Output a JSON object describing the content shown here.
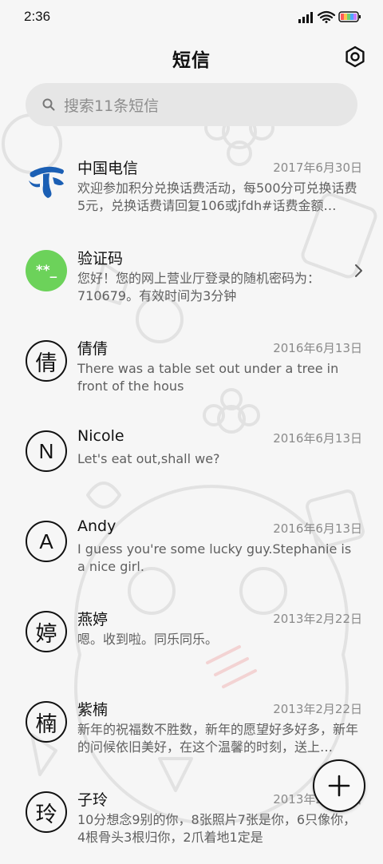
{
  "status_bar": {
    "time": "2:36",
    "icons": [
      "signal-icon",
      "wifi-icon",
      "battery-icon"
    ]
  },
  "header": {
    "title": "短信",
    "settings_icon": "settings-icon"
  },
  "search": {
    "placeholder": "搜索11条短信",
    "icon": "search-icon"
  },
  "conversations": [
    {
      "name": "中国电信",
      "date": "2017年6月30日",
      "preview": "欢迎参加积分兑换话费活动，每500分可兑换话费5元，兑换话费请回复106或jfdh#话费金额…",
      "avatar": "china-telecom-logo"
    },
    {
      "name": "验证码",
      "date": "",
      "preview": "您好！您的网上营业厅登录的随机密码为：710679。有效时间为3分钟",
      "avatar": "**_"
    },
    {
      "name": "倩倩",
      "date": "2016年6月13日",
      "preview": "There was a table set out under a tree in front of the hous",
      "avatar": "倩"
    },
    {
      "name": "Nicole",
      "date": "2016年6月13日",
      "preview": "Let's eat out,shall we?",
      "avatar": "N"
    },
    {
      "name": "Andy",
      "date": "2016年6月13日",
      "preview": "I guess you're some lucky guy.Stephanie is a nice girl.",
      "avatar": "A"
    },
    {
      "name": "燕婷",
      "date": "2013年2月22日",
      "preview": "嗯。收到啦。同乐同乐。",
      "avatar": "婷"
    },
    {
      "name": "紫楠",
      "date": "2013年2月22日",
      "preview": "新年的祝福数不胜数，新年的愿望好多好多，新年的问候依旧美好，在这个温馨的时刻，送上…",
      "avatar": "楠"
    },
    {
      "name": "子玲",
      "date": "2013年2月22日",
      "preview": "10分想念9别的你，8张照片7张是你，6只像你，4根骨头3根归你，2爪着地1定是",
      "avatar": "玲"
    }
  ],
  "fab": {
    "icon": "plus-icon"
  },
  "colors": {
    "background": "#f6f6f6",
    "search_bg": "#e6e6e6",
    "code_avatar": "#6cd25a",
    "telecom_blue": "#1b5fb4",
    "secondary_text": "#5f5f5f",
    "date_text": "#8a8a8a"
  }
}
